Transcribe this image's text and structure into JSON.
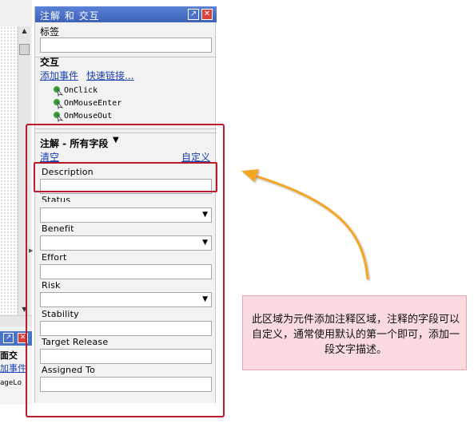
{
  "panel": {
    "title": "注解 和 交互",
    "pin_glyph": "↗",
    "close_glyph": "✕",
    "label_section": "标签",
    "label_input_value": "",
    "interaction_heading": "交互",
    "add_event_link": "添加事件",
    "quick_link": "快速链接...",
    "events": [
      "OnClick",
      "OnMouseEnter",
      "OnMouseOut"
    ],
    "notes_heading": "注解 - 所有字段",
    "notes_dropdown_glyph": "▼",
    "clear_link": "清空",
    "customize_link": "自定义",
    "fields": [
      {
        "label": "Description",
        "type": "text",
        "value": ""
      },
      {
        "label": "Status",
        "type": "select",
        "value": ""
      },
      {
        "label": "Benefit",
        "type": "select",
        "value": ""
      },
      {
        "label": "Effort",
        "type": "text",
        "value": ""
      },
      {
        "label": "Risk",
        "type": "select",
        "value": ""
      },
      {
        "label": "Stability",
        "type": "text",
        "value": ""
      },
      {
        "label": "Target Release",
        "type": "text",
        "value": ""
      },
      {
        "label": "Assigned To",
        "type": "text",
        "value": ""
      }
    ]
  },
  "left_strip": {
    "mini_title_text": "面交",
    "mini_link_text": "加事件",
    "mini_event_text": "ageLo"
  },
  "note": {
    "text": "此区域为元件添加注释区域，注释的字段可以自定义，通常使用默认的第一个即可，添加一段文字描述。"
  },
  "colors": {
    "titlebar": "#4a72c9",
    "annotation_red": "#b91c2a",
    "arrow_orange": "#f5a623",
    "note_bg": "#f9dadf",
    "link_blue": "#1a3fb3"
  }
}
